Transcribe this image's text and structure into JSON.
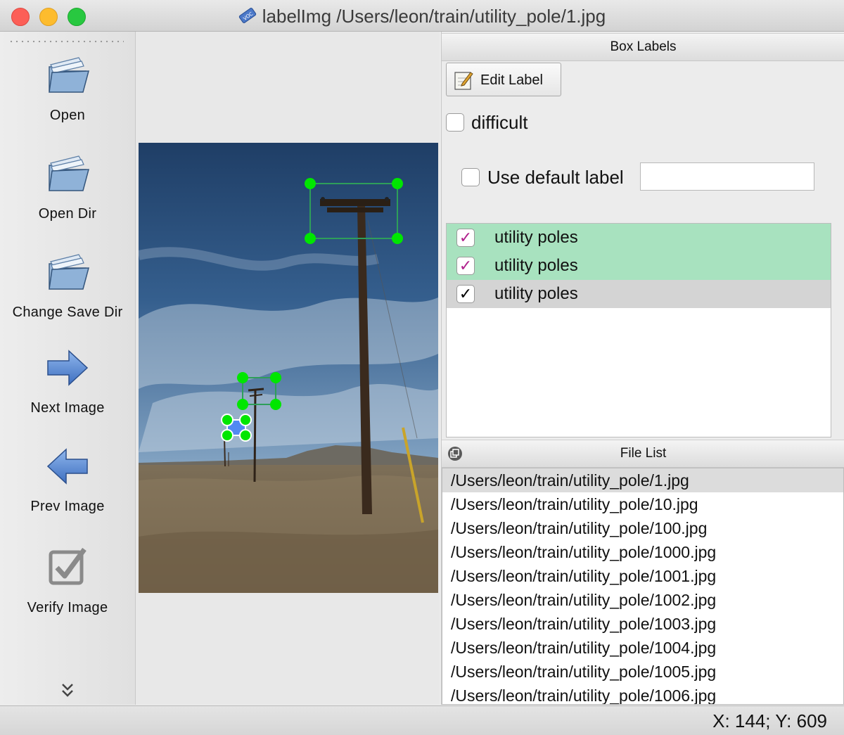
{
  "window": {
    "title": "labelImg /Users/leon/train/utility_pole/1.jpg",
    "app_icon": "voc-tag-icon"
  },
  "toolbar": {
    "items": [
      {
        "label": "Open",
        "icon": "folder-icon"
      },
      {
        "label": "Open Dir",
        "icon": "folder-icon"
      },
      {
        "label": "Change Save Dir",
        "icon": "folder-icon"
      },
      {
        "label": "Next Image",
        "icon": "arrow-right-icon"
      },
      {
        "label": "Prev Image",
        "icon": "arrow-left-icon"
      },
      {
        "label": "Verify Image",
        "icon": "checkbox-icon"
      }
    ],
    "more_icon": "double-chevron-down-icon"
  },
  "box_labels": {
    "title": "Box Labels",
    "edit_label_button": "Edit Label",
    "difficult_label": "difficult",
    "difficult_checked": false,
    "use_default_label": "Use default label",
    "use_default_checked": false,
    "default_label_value": "",
    "labels": [
      {
        "text": "utility poles",
        "checked": true,
        "highlight": "#a8e2bf",
        "check_color": "#b0208c"
      },
      {
        "text": "utility poles",
        "checked": true,
        "highlight": "#a8e2bf",
        "check_color": "#b0208c"
      },
      {
        "text": "utility poles",
        "checked": true,
        "highlight": "#d4d4d4",
        "check_color": "#000000"
      }
    ]
  },
  "file_list": {
    "title": "File List",
    "files": [
      "/Users/leon/train/utility_pole/1.jpg",
      "/Users/leon/train/utility_pole/10.jpg",
      "/Users/leon/train/utility_pole/100.jpg",
      "/Users/leon/train/utility_pole/1000.jpg",
      "/Users/leon/train/utility_pole/1001.jpg",
      "/Users/leon/train/utility_pole/1002.jpg",
      "/Users/leon/train/utility_pole/1003.jpg",
      "/Users/leon/train/utility_pole/1004.jpg",
      "/Users/leon/train/utility_pole/1005.jpg",
      "/Users/leon/train/utility_pole/1006.jpg"
    ],
    "selected_index": 0
  },
  "status": {
    "coords": "X: 144; Y: 609"
  },
  "colors": {
    "box_handle": "#00e600",
    "box_line": "#2e9e5a",
    "selected_box_fill": "#3a7bff"
  }
}
